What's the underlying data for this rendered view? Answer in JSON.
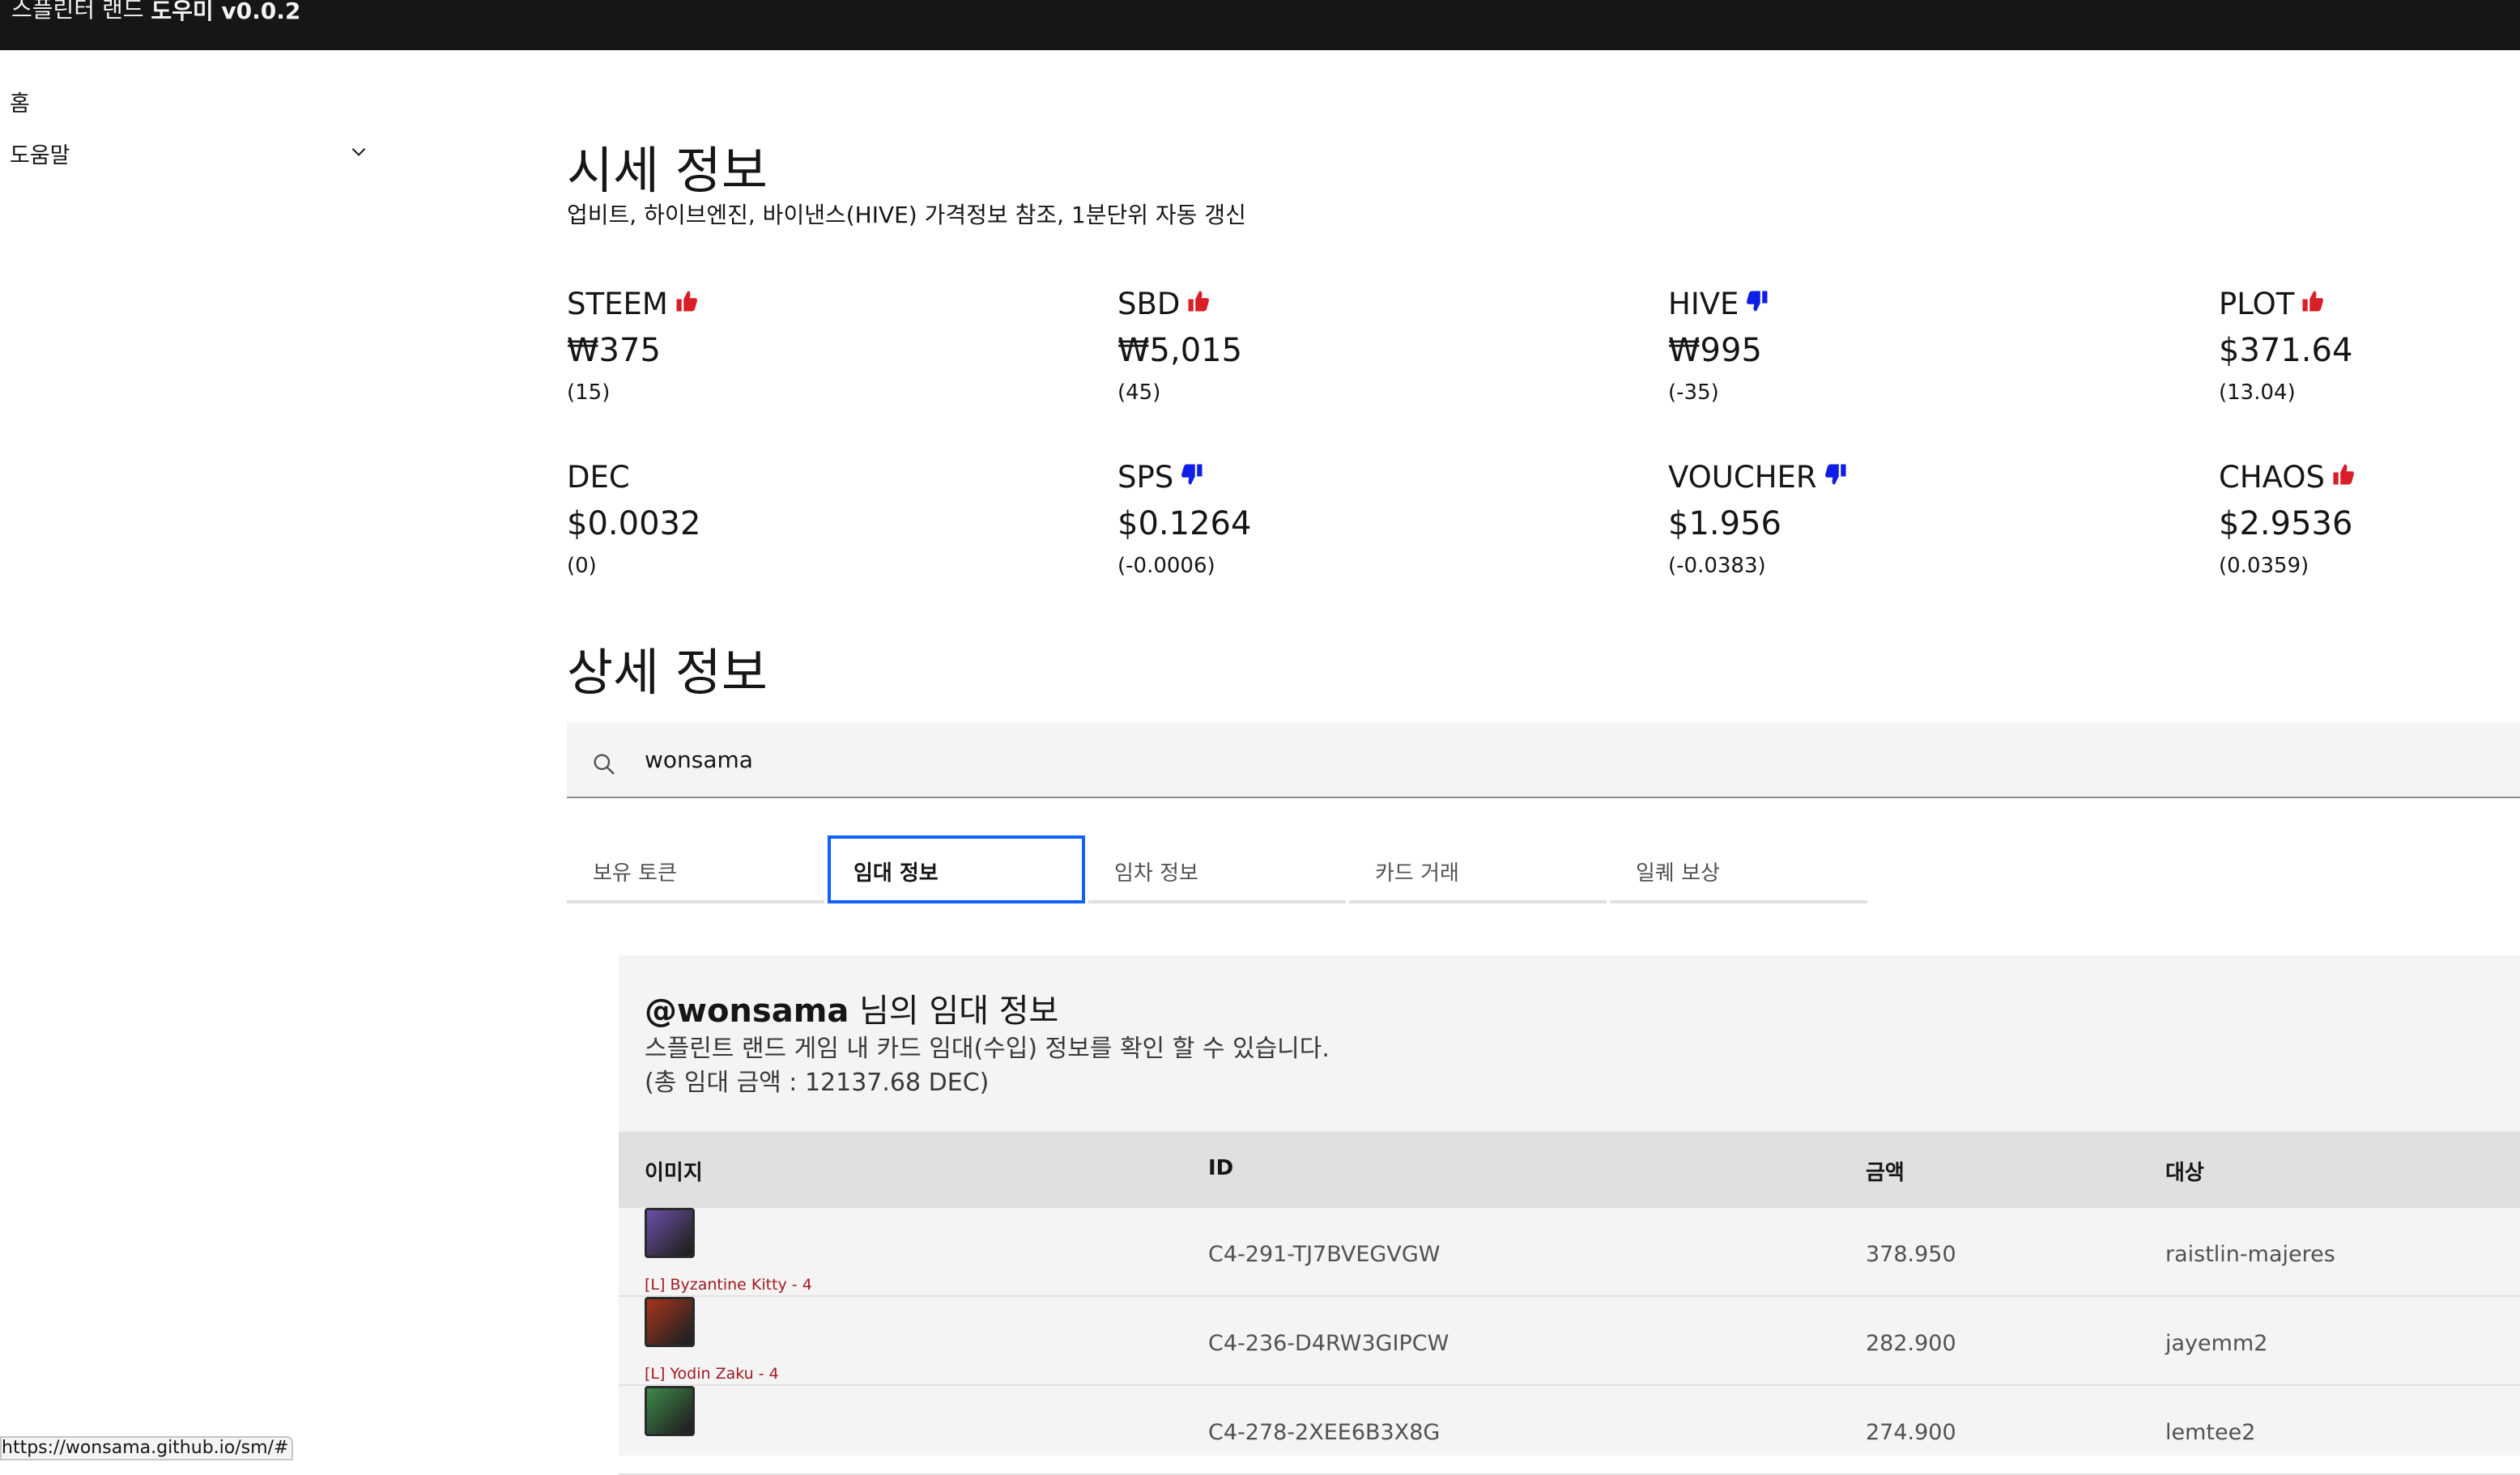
{
  "app": {
    "brand_prefix": "스플린터 랜드",
    "brand_suffix": "도우미 v0.0.2"
  },
  "sidebar": {
    "items": [
      {
        "label": "홈"
      },
      {
        "label": "도움말"
      }
    ]
  },
  "prices": {
    "title": "시세 정보",
    "subtitle": "업비트, 하이브엔진, 바이낸스(HIVE) 가격정보 참조, 1분단위 자동 갱신",
    "items": [
      {
        "name": "STEEM",
        "value": "₩375",
        "change": "(15)",
        "trend": "up"
      },
      {
        "name": "SBD",
        "value": "₩5,015",
        "change": "(45)",
        "trend": "up"
      },
      {
        "name": "HIVE",
        "value": "₩995",
        "change": "(-35)",
        "trend": "down"
      },
      {
        "name": "PLOT",
        "value": "$371.64",
        "change": "(13.04)",
        "trend": "up"
      },
      {
        "name": "DEC",
        "value": "$0.0032",
        "change": "(0)",
        "trend": "none"
      },
      {
        "name": "SPS",
        "value": "$0.1264",
        "change": "(-0.0006)",
        "trend": "down"
      },
      {
        "name": "VOUCHER",
        "value": "$1.956",
        "change": "(-0.0383)",
        "trend": "down"
      },
      {
        "name": "CHAOS",
        "value": "$2.9536",
        "change": "(0.0359)",
        "trend": "up"
      }
    ],
    "colors": {
      "up": "#da1e28",
      "down": "#0f1ee6"
    }
  },
  "details": {
    "title": "상세 정보",
    "search": {
      "value": "wonsama",
      "icon": "search-icon"
    },
    "tabs": [
      {
        "label": "보유 토큰",
        "active": false
      },
      {
        "label": "임대 정보",
        "active": true
      },
      {
        "label": "임차 정보",
        "active": false
      },
      {
        "label": "카드 거래",
        "active": false
      },
      {
        "label": "일퀘 보상",
        "active": false
      }
    ],
    "panel": {
      "title_user": "@wonsama",
      "title_rest": " 님의 임대 정보",
      "description": "스플린트 랜드 게임 내 카드 임대(수입) 정보를 확인 할 수 있습니다.",
      "total": "(총 임대 금액 : 12137.68 DEC)"
    },
    "table": {
      "columns": [
        "이미지",
        "ID",
        "금액",
        "대상"
      ],
      "rows": [
        {
          "card": "[L] Byzantine Kitty - 4",
          "id": "C4-291-TJ7BVEGVGW",
          "amount": "378.950",
          "target": "raistlin-majeres",
          "thumb_color": "#6b4fa8"
        },
        {
          "card": "[L] Yodin Zaku - 4",
          "id": "C4-236-D4RW3GIPCW",
          "amount": "282.900",
          "target": "jayemm2",
          "thumb_color": "#a8341c"
        },
        {
          "card": "",
          "id": "C4-278-2XEE6B3X8G",
          "amount": "274.900",
          "target": "lemtee2",
          "thumb_color": "#3e8a4a"
        }
      ]
    }
  },
  "statusbar": {
    "url": "https://wonsama.github.io/sm/#"
  }
}
